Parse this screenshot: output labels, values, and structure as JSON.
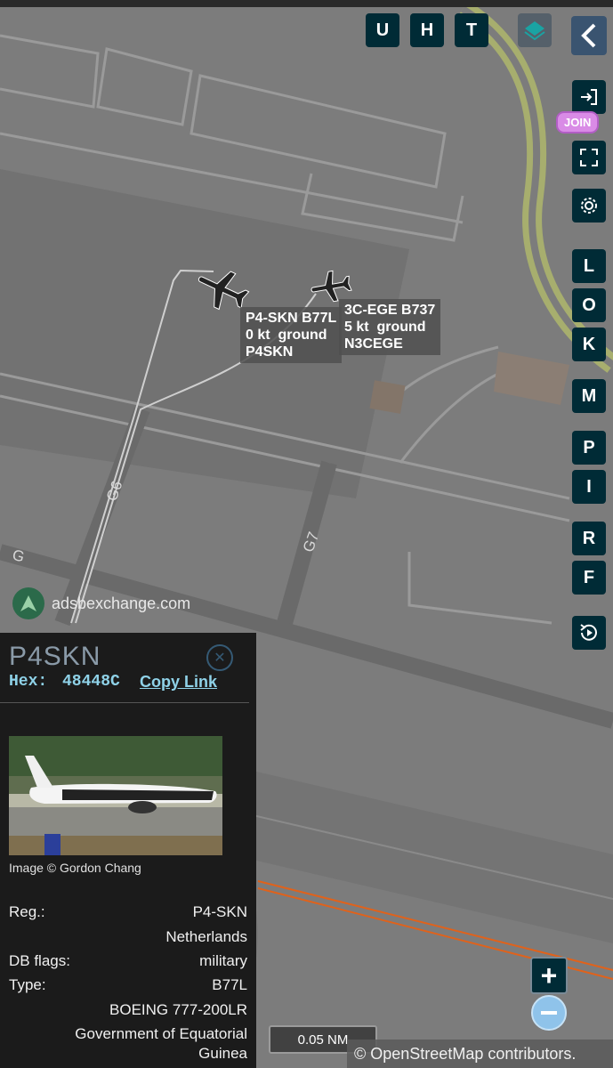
{
  "map": {
    "taxiway_labels": [
      "G6",
      "G",
      "G7"
    ],
    "watermark": "adsbexchange.com",
    "attribution": "© OpenStreetMap contributors.",
    "scale": "0.05 NM"
  },
  "aircraft": [
    {
      "line1": "P4-SKN B77L",
      "line2": "0 kt  ground",
      "line3": "P4SKN"
    },
    {
      "line1": "3C-EGE B737",
      "line2": "5 kt  ground",
      "line3": "N3CEGE"
    }
  ],
  "toolbar": {
    "top_buttons": [
      "U",
      "H",
      "T"
    ],
    "join_label": "JOIN",
    "side_buttons": [
      "L",
      "O",
      "K",
      "M",
      "P",
      "I",
      "R",
      "F"
    ]
  },
  "panel": {
    "callsign": "P4SKN",
    "hex_label": "Hex:",
    "hex_value": "48448C",
    "copy_link": "Copy Link",
    "image_credit": "Image © Gordon Chang",
    "reg_label": "Reg.:",
    "reg_value": "P4-SKN",
    "country": "Netherlands",
    "dbflags_label": "DB flags:",
    "dbflags_value": "military",
    "type_label": "Type:",
    "type_value": "B77L",
    "type_full": "BOEING 777-200LR",
    "operator_line1": "Government of Equatorial",
    "operator_line2": "Guinea"
  },
  "colors": {
    "map_bg": "#7d7d7d",
    "button_bg": "#002b36",
    "panel_bg": "#1b1b1b",
    "accent": "#8fd2e8",
    "track_orange": "#e0621b"
  }
}
